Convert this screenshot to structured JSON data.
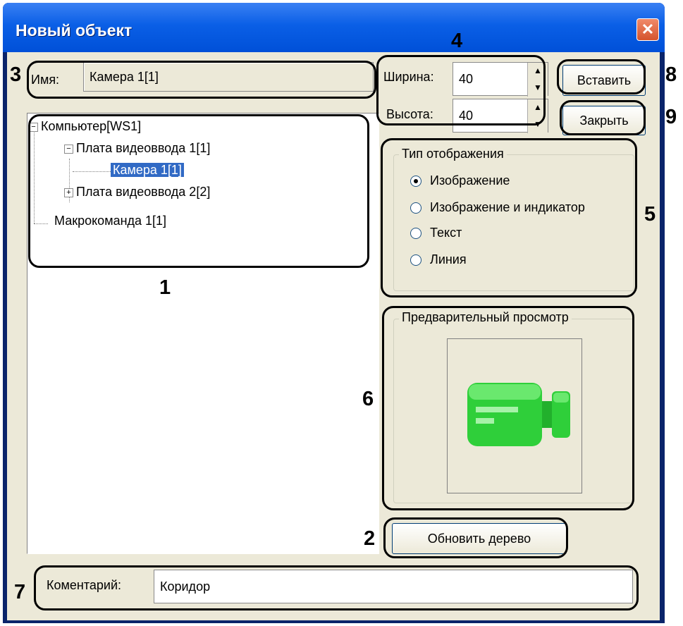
{
  "window": {
    "title": "Новый объект",
    "close_glyph": "✕"
  },
  "name_field": {
    "label": "Имя:",
    "value": "Камера 1[1]"
  },
  "size": {
    "width_label": "Ширина:",
    "width_value": "40",
    "height_label": "Высота:",
    "height_value": "40"
  },
  "buttons": {
    "insert": "Вставить",
    "close": "Закрыть",
    "refresh": "Обновить дерево"
  },
  "tree": {
    "items": [
      {
        "label": "Компьютер[WS1]",
        "expander": "−"
      },
      {
        "label": "Плата видеоввода 1[1]",
        "expander": "−"
      },
      {
        "label": "Камера 1[1]",
        "selected": true
      },
      {
        "label": "Плата видеоввода 2[2]",
        "expander": "+"
      },
      {
        "label": "Макрокоманда 1[1]"
      }
    ]
  },
  "display_type": {
    "title": "Тип отображения",
    "options": [
      {
        "label": "Изображение",
        "selected": true
      },
      {
        "label": "Изображение и индикатор",
        "selected": false
      },
      {
        "label": "Текст",
        "selected": false
      },
      {
        "label": "Линия",
        "selected": false
      }
    ]
  },
  "preview": {
    "title": "Предварительный просмотр",
    "icon": "camera-icon",
    "icon_color": "#2fcf3a"
  },
  "comment": {
    "label": "Коментарий:",
    "value": "Коридор"
  },
  "callout_numbers": [
    "1",
    "2",
    "3",
    "4",
    "5",
    "6",
    "7",
    "8",
    "9"
  ],
  "colors": {
    "titlebar": "#0a5fe6",
    "dialog_bg": "#ece9d8",
    "selection": "#316ac5"
  }
}
